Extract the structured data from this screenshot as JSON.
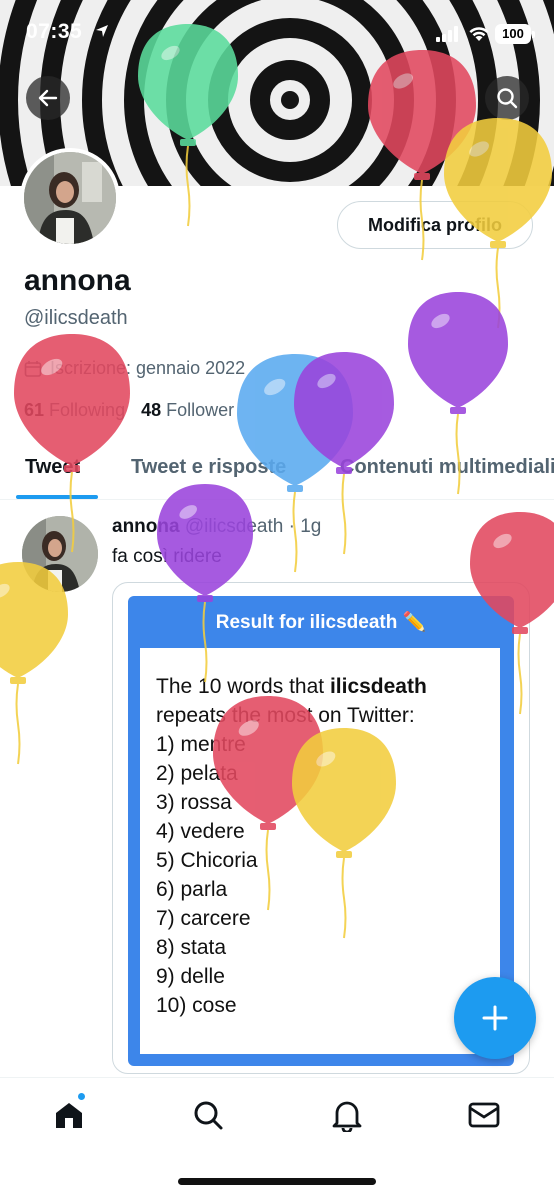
{
  "status_bar": {
    "time": "07:35",
    "battery": "100"
  },
  "icons": {
    "back": "arrow-left-icon",
    "search": "search-icon",
    "location": "location-arrow-icon",
    "calendar": "calendar-icon",
    "compose": "plus-icon",
    "home": "home-icon",
    "explore": "search-icon",
    "notifications": "bell-icon",
    "messages": "mail-icon"
  },
  "profile": {
    "edit_button": "Modifica profilo",
    "display_name": "annona",
    "handle": "@ilicsdeath",
    "joined": "Iscrizione: gennaio 2022",
    "following_count": "61",
    "following_label": "Following",
    "followers_count": "48",
    "followers_label": "Follower"
  },
  "tabs": [
    "Tweet",
    "Tweet e risposte",
    "Contenuti multimediali"
  ],
  "tweet": {
    "author": "annona",
    "handle": "@ilicsdeath",
    "time": "· 1g",
    "text": "fa così ridere",
    "card": {
      "title": "Result for ilicsdeath ✏️",
      "intro_prefix": "The 10 words that ",
      "intro_bold": "ilicsdeath",
      "intro_suffix": " repeats the most on Twitter:",
      "words": [
        "1) mentre",
        "2) pelata",
        "3) rossa",
        "4) vedere",
        "5) Chicoria",
        "6) parla",
        "7) carcere",
        "8) stata",
        "9) delle",
        "10) cose"
      ]
    }
  },
  "colors": {
    "accent": "#1d9bf0",
    "card_blue": "#3d86ea",
    "balloon_red": "#e2485f",
    "balloon_yellow": "#f2cd3e",
    "balloon_purple": "#9a44dc",
    "balloon_blue": "#5aaaf0",
    "balloon_green": "#5bdc9c"
  }
}
